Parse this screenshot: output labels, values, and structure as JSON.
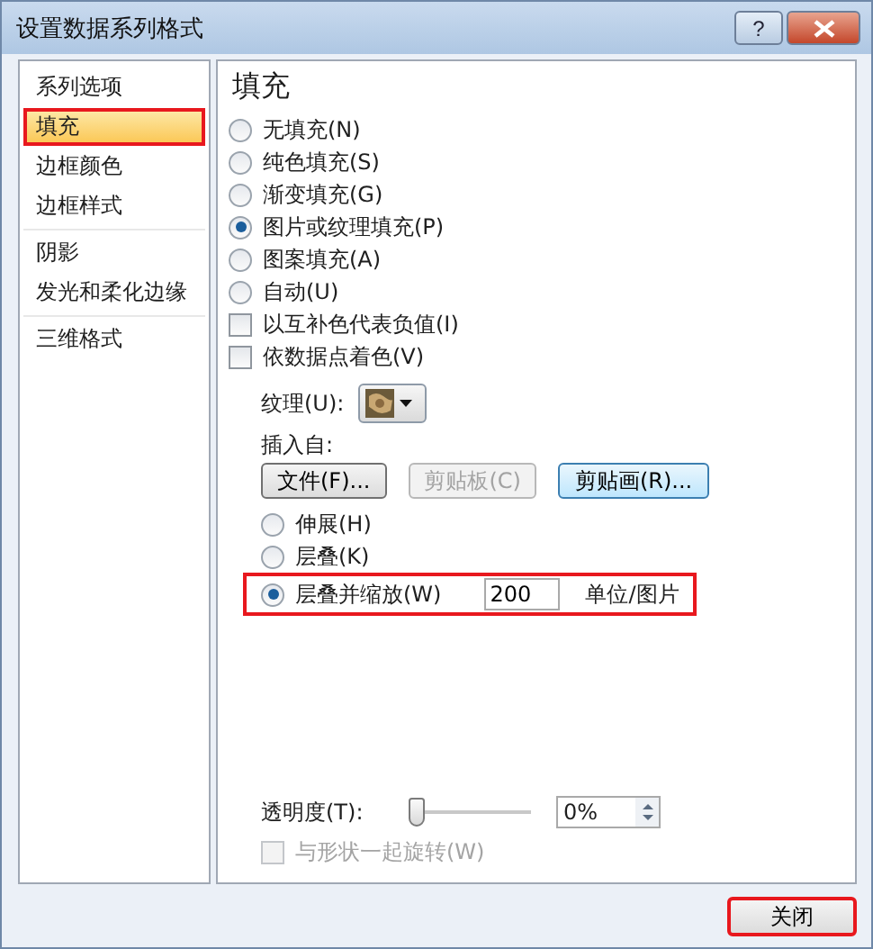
{
  "window": {
    "title": "设置数据系列格式",
    "help_label": "?"
  },
  "sidebar": {
    "groups": [
      [
        {
          "label": "系列选项",
          "selected": false,
          "annotated": false
        },
        {
          "label": "填充",
          "selected": true,
          "annotated": true
        },
        {
          "label": "边框颜色",
          "selected": false,
          "annotated": false
        },
        {
          "label": "边框样式",
          "selected": false,
          "annotated": false
        }
      ],
      [
        {
          "label": "阴影",
          "selected": false,
          "annotated": false
        },
        {
          "label": "发光和柔化边缘",
          "selected": false,
          "annotated": false
        }
      ],
      [
        {
          "label": "三维格式",
          "selected": false,
          "annotated": false
        }
      ]
    ]
  },
  "panel": {
    "heading": "填充",
    "fill_options": [
      {
        "kind": "radio",
        "label": "无填充(N)",
        "selected": false
      },
      {
        "kind": "radio",
        "label": "纯色填充(S)",
        "selected": false
      },
      {
        "kind": "radio",
        "label": "渐变填充(G)",
        "selected": false
      },
      {
        "kind": "radio",
        "label": "图片或纹理填充(P)",
        "selected": true
      },
      {
        "kind": "radio",
        "label": "图案填充(A)",
        "selected": false
      },
      {
        "kind": "radio",
        "label": "自动(U)",
        "selected": false
      },
      {
        "kind": "checkbox",
        "label": "以互补色代表负值(I)",
        "checked": false
      },
      {
        "kind": "checkbox",
        "label": "依数据点着色(V)",
        "checked": false
      }
    ],
    "texture": {
      "label": "纹理(U):"
    },
    "insert_from": {
      "label": "插入自:",
      "buttons": [
        {
          "label": "文件(F)...",
          "disabled": false,
          "highlighted": false
        },
        {
          "label": "剪贴板(C)",
          "disabled": true,
          "highlighted": false
        },
        {
          "label": "剪贴画(R)...",
          "disabled": false,
          "highlighted": true
        }
      ]
    },
    "layout_options": [
      {
        "label": "伸展(H)",
        "selected": false,
        "annotated": false
      },
      {
        "label": "层叠(K)",
        "selected": false,
        "annotated": false
      },
      {
        "label": "层叠并缩放(W)",
        "selected": true,
        "annotated": true,
        "value": "200",
        "unit": "单位/图片"
      }
    ],
    "transparency": {
      "label": "透明度(T):",
      "level": 0,
      "value": "0%"
    },
    "rotate": {
      "label": "与形状一起旋转(W)",
      "checked": false,
      "disabled": true
    }
  },
  "footer": {
    "close_button": {
      "label": "关闭",
      "annotated": true
    }
  }
}
